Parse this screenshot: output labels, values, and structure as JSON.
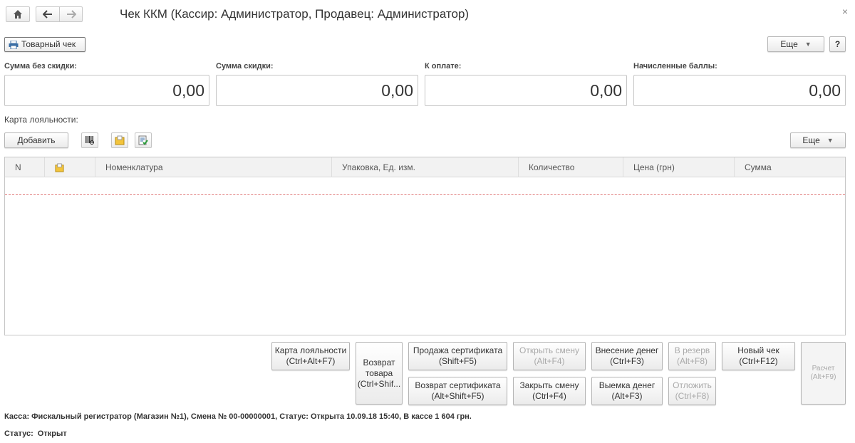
{
  "window": {
    "title": "Чек ККМ (Кассир: Администратор, Продавец: Администратор)",
    "close_glyph": "×"
  },
  "nav": {
    "home_icon": "home-icon",
    "back_icon": "arrow-left-icon",
    "forward_icon": "arrow-right-icon"
  },
  "toolbar": {
    "product_receipt_label": "Товарный чек",
    "more_label": "Еще",
    "help_label": "?"
  },
  "summary": [
    {
      "label": "Сумма без скидки:",
      "value": "0,00"
    },
    {
      "label": "Сумма скидки:",
      "value": "0,00"
    },
    {
      "label": "К оплате:",
      "value": "0,00"
    },
    {
      "label": "Начисленные баллы:",
      "value": "0,00"
    }
  ],
  "loyalty": {
    "label": "Карта лояльности:"
  },
  "list_toolbar": {
    "add_label": "Добавить",
    "more_label": "Еще"
  },
  "table": {
    "columns": [
      "N",
      "",
      "Номенклатура",
      "Упаковка, Ед. изм.",
      "Количество",
      "Цена (грн)",
      "Сумма"
    ],
    "rows": []
  },
  "actions": {
    "loyalty_card": "Карта лояльности\n(Ctrl+Alt+F7)",
    "return_goods": "Возврат\nтовара\n(Ctrl+Shif...",
    "sell_certificate": "Продажа сертификата\n(Shift+F5)",
    "return_certificate": "Возврат сертификата\n(Alt+Shift+F5)",
    "open_shift": "Открыть смену\n(Alt+F4)",
    "close_shift": "Закрыть смену\n(Ctrl+F4)",
    "cash_in": "Внесение денег\n(Ctrl+F3)",
    "cash_out": "Выемка денег\n(Alt+F3)",
    "reserve": "В резерв\n(Alt+F8)",
    "postpone": "Отложить\n(Ctrl+F8)",
    "new_receipt": "Новый чек\n(Ctrl+F12)",
    "payment": "Расчет\n(Alt+F9)"
  },
  "footer": {
    "kassa_info": "Касса: Фискальный регистратор (Магазин №1), Смена № 00-00000001, Статус: Открыта 10.09.18 15:40, В кассе 1 604 грн.",
    "status_label": "Статус:",
    "status_value": "Открыт"
  }
}
